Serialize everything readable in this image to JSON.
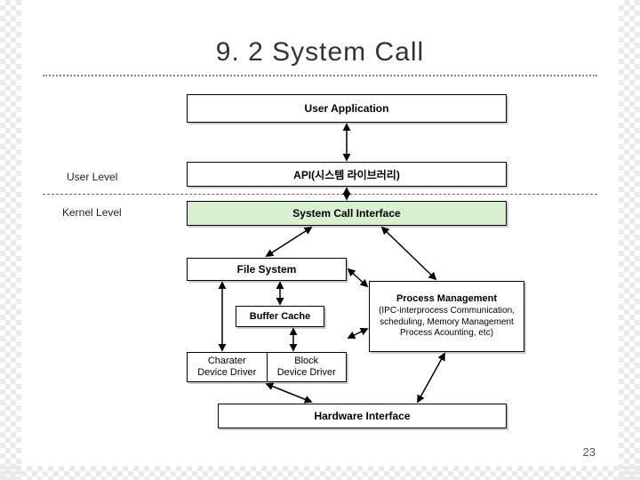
{
  "title": "9. 2 System Call",
  "page_number": "23",
  "labels": {
    "user_level": "User Level",
    "kernel_level": "Kernel Level"
  },
  "boxes": {
    "user_app": "User Application",
    "api": "API(시스템 라이브러리)",
    "sci": "System Call Interface",
    "fs": "File System",
    "buffer": "Buffer Cache",
    "char_drv": "Charater\nDevice Driver",
    "block_drv": "Block\nDevice Driver",
    "pm_title": "Process Management",
    "pm_sub": "(IPC-interprocess Communication, scheduling, Memory Management Process Acounting, etc)",
    "hw": "Hardware Interface"
  }
}
